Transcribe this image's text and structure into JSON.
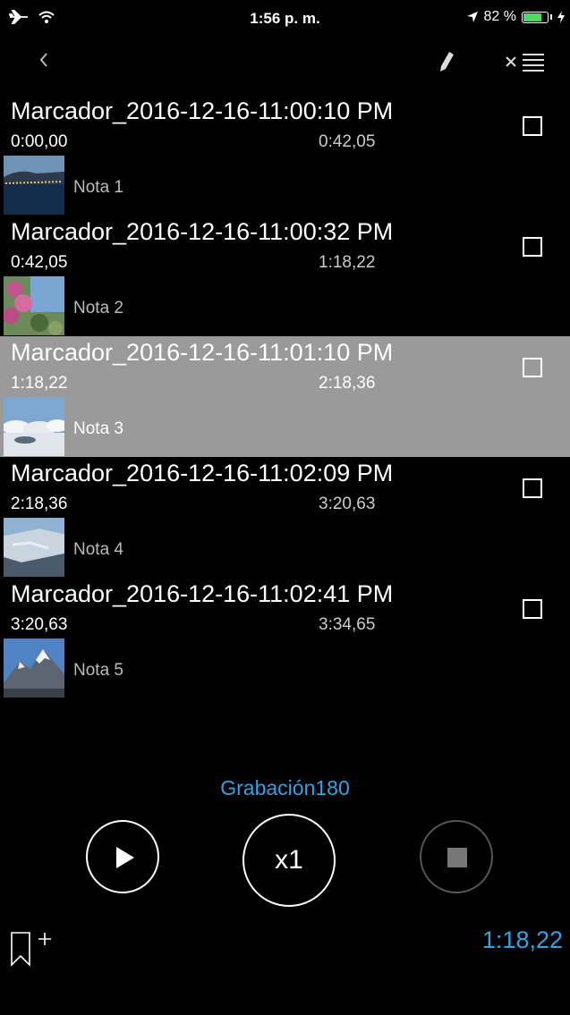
{
  "status_bar": {
    "time": "1:56 p. m.",
    "battery_percent": "82 %",
    "battery_level": 0.82,
    "icons": [
      "airplane-icon",
      "wifi-icon",
      "location-arrow-icon",
      "battery-icon",
      "charging-icon"
    ]
  },
  "nav": {
    "back_icon": "chevron-left-icon",
    "edit_icon": "pencil-icon",
    "delete_list_icon": "clear-list-icon"
  },
  "markers": [
    {
      "title": "Marcador_2016-12-16-11:00:10 PM",
      "start": "0:00,00",
      "end": "0:42,05",
      "note": "Nota 1",
      "selected": false,
      "thumb": "night-coast"
    },
    {
      "title": "Marcador_2016-12-16-11:00:32 PM",
      "start": "0:42,05",
      "end": "1:18,22",
      "note": "Nota 2",
      "selected": false,
      "thumb": "flowers"
    },
    {
      "title": "Marcador_2016-12-16-11:01:10 PM",
      "start": "1:18,22",
      "end": "2:18,36",
      "note": "Nota 3",
      "selected": true,
      "thumb": "clouds"
    },
    {
      "title": "Marcador_2016-12-16-11:02:09 PM",
      "start": "2:18,36",
      "end": "3:20,63",
      "note": "Nota 4",
      "selected": false,
      "thumb": "glacier"
    },
    {
      "title": "Marcador_2016-12-16-11:02:41 PM",
      "start": "3:20,63",
      "end": "3:34,65",
      "note": "Nota 5",
      "selected": false,
      "thumb": "mountain"
    }
  ],
  "player": {
    "recording_name": "Grabación180",
    "speed_label": "x1",
    "current_time": "1:18,22"
  },
  "colors": {
    "accent": "#2fa3e6",
    "selected_row": "#9a9a9a",
    "background": "#000000"
  }
}
